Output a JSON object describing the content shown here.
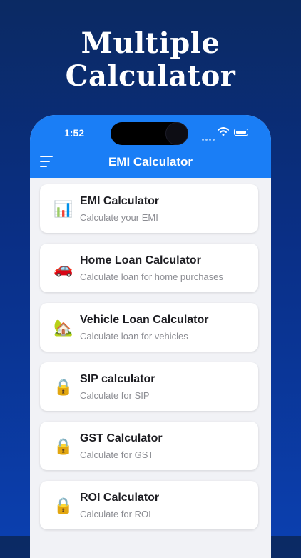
{
  "headline": {
    "line1": "Multiple",
    "line2": "Calculator"
  },
  "status_bar": {
    "time": "1:52"
  },
  "app_bar": {
    "title": "EMI Calculator"
  },
  "calculators": [
    {
      "title": "EMI Calculator",
      "subtitle": "Calculate your EMI",
      "icon": "bar-chart-icon",
      "glyph": "📊"
    },
    {
      "title": "Home Loan Calculator",
      "subtitle": "Calculate loan for home purchases",
      "icon": "car-icon",
      "glyph": "🚗"
    },
    {
      "title": "Vehicle Loan Calculator",
      "subtitle": "Calculate loan for vehicles",
      "icon": "house-icon",
      "glyph": "🏡"
    },
    {
      "title": "SIP calculator",
      "subtitle": "Calculate for SIP",
      "icon": "lock-icon",
      "glyph": "🔒"
    },
    {
      "title": "GST Calculator",
      "subtitle": "Calculate for GST",
      "icon": "lock-icon",
      "glyph": "🔒"
    },
    {
      "title": "ROI Calculator",
      "subtitle": "Calculate for ROI",
      "icon": "lock-icon",
      "glyph": "🔒"
    }
  ],
  "colors": {
    "app_bar": "#1a7ef6",
    "background_top": "#0b2a63",
    "background_bottom": "#0b3fae"
  }
}
